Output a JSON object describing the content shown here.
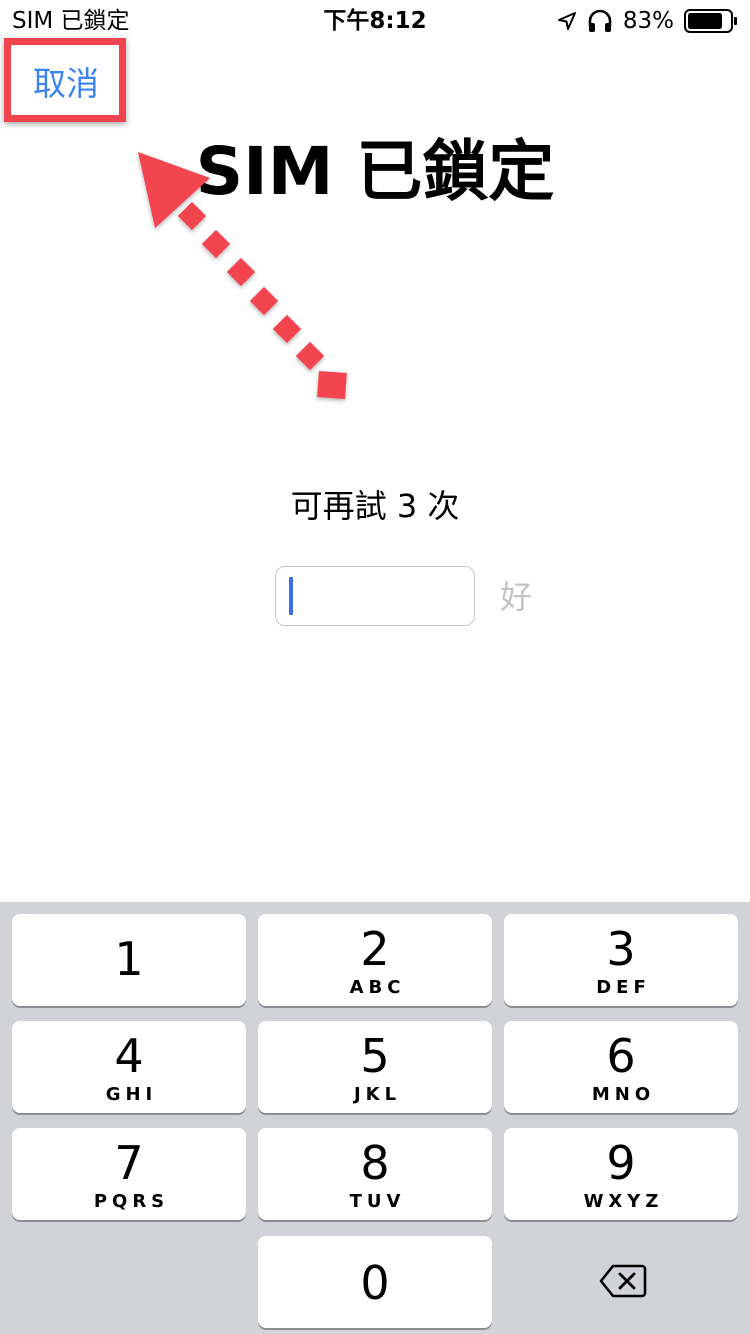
{
  "status_bar": {
    "carrier": "SIM 已鎖定",
    "time": "下午8:12",
    "battery_percent": "83%",
    "battery_level": 0.83,
    "icons": [
      "location-arrow-icon",
      "headphones-icon",
      "battery-icon"
    ]
  },
  "header": {
    "cancel_label": "取消",
    "title": "SIM 已鎖定"
  },
  "annotation": {
    "highlight_color": "#f2444f",
    "arrow_target": "cancel-button"
  },
  "pin_entry": {
    "tries_label": "可再試 3 次",
    "value": "",
    "ok_label": "好"
  },
  "colors": {
    "accent": "#3a84f0",
    "caret": "#3c6ee6",
    "disabled": "#c4c4c8",
    "keypad_bg": "#d1d3d9"
  },
  "keypad": {
    "keys": [
      {
        "digit": "1",
        "letters": ""
      },
      {
        "digit": "2",
        "letters": "ABC"
      },
      {
        "digit": "3",
        "letters": "DEF"
      },
      {
        "digit": "4",
        "letters": "GHI"
      },
      {
        "digit": "5",
        "letters": "JKL"
      },
      {
        "digit": "6",
        "letters": "MNO"
      },
      {
        "digit": "7",
        "letters": "PQRS"
      },
      {
        "digit": "8",
        "letters": "TUV"
      },
      {
        "digit": "9",
        "letters": "WXYZ"
      },
      {
        "digit": "0",
        "letters": ""
      }
    ],
    "delete_icon": "backspace-icon"
  }
}
